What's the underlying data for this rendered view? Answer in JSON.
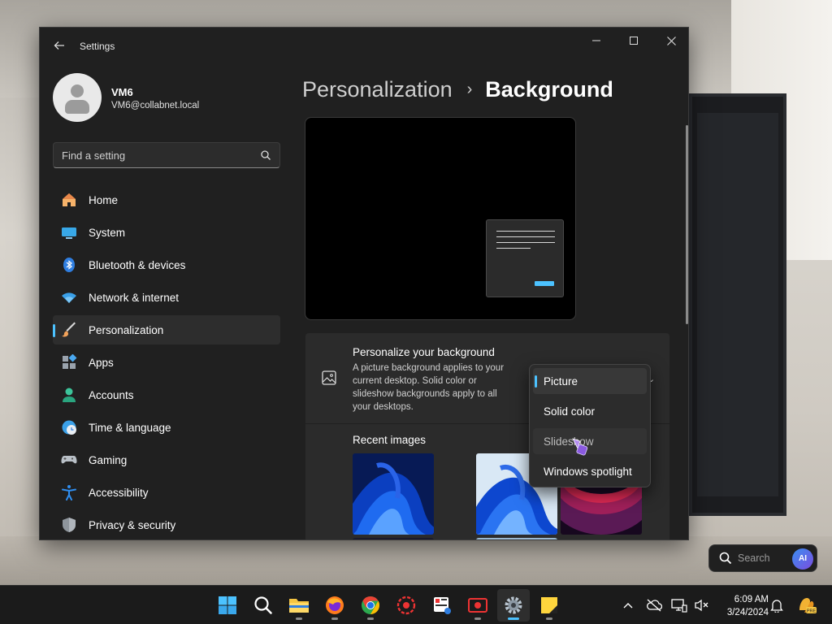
{
  "window": {
    "app_title": "Settings",
    "controls": {
      "minimize": "minimize",
      "maximize": "maximize",
      "close": "close"
    }
  },
  "profile": {
    "name": "VM6",
    "email": "VM6@collabnet.local"
  },
  "search": {
    "placeholder": "Find a setting"
  },
  "sidebar": {
    "items": [
      {
        "label": "Home",
        "icon": "home-icon"
      },
      {
        "label": "System",
        "icon": "system-icon"
      },
      {
        "label": "Bluetooth & devices",
        "icon": "bluetooth-icon"
      },
      {
        "label": "Network & internet",
        "icon": "network-icon"
      },
      {
        "label": "Personalization",
        "icon": "personalization-icon",
        "active": true
      },
      {
        "label": "Apps",
        "icon": "apps-icon"
      },
      {
        "label": "Accounts",
        "icon": "accounts-icon"
      },
      {
        "label": "Time & language",
        "icon": "time-language-icon"
      },
      {
        "label": "Gaming",
        "icon": "gaming-icon"
      },
      {
        "label": "Accessibility",
        "icon": "accessibility-icon"
      },
      {
        "label": "Privacy & security",
        "icon": "privacy-icon"
      }
    ]
  },
  "breadcrumb": {
    "parent": "Personalization",
    "separator": "›",
    "current": "Background"
  },
  "background_card": {
    "title": "Personalize your background",
    "description": "A picture background applies to your current desktop. Solid color or slideshow backgrounds apply to all your desktops."
  },
  "dropdown": {
    "selected": "Picture",
    "options": [
      "Picture",
      "Solid color",
      "Slideshow",
      "Windows spotlight"
    ]
  },
  "recent_images": {
    "label": "Recent images"
  },
  "taskbar": {
    "search_text": "Search",
    "ai_badge": "AI",
    "time": "6:09 AM",
    "date": "3/24/2024",
    "apps": [
      "start",
      "search",
      "file-explorer",
      "firefox",
      "chrome",
      "app-red",
      "snipping",
      "recorder",
      "settings",
      "sticky-notes"
    ]
  },
  "colors": {
    "accent": "#4cc2ff",
    "window_bg": "#202020",
    "card_bg": "#2b2b2b"
  }
}
